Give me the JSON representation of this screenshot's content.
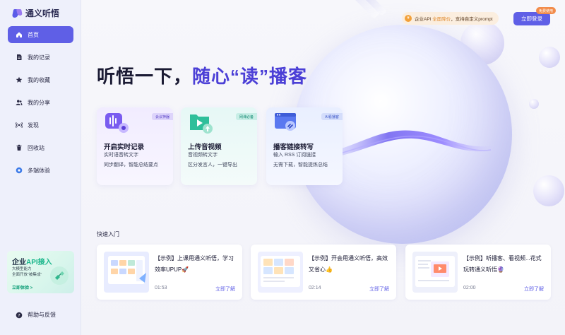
{
  "app": {
    "name": "通义听悟"
  },
  "sidebar": {
    "items": [
      {
        "label": "首页",
        "icon": "home-icon",
        "active": true
      },
      {
        "label": "我的记录",
        "icon": "document-icon",
        "active": false
      },
      {
        "label": "我的收藏",
        "icon": "star-icon",
        "active": false
      },
      {
        "label": "我的分享",
        "icon": "users-icon",
        "active": false
      },
      {
        "label": "发现",
        "icon": "radio-icon",
        "active": false
      },
      {
        "label": "回收站",
        "icon": "trash-icon",
        "active": false
      },
      {
        "label": "多端体验",
        "icon": "devices-icon",
        "active": false
      }
    ],
    "promo": {
      "title_a": "企业",
      "title_b": "API接入",
      "line1": "大模型能力",
      "line2": "全面开放“被集成”",
      "cta": "立即体验 >"
    },
    "help": "帮助与反馈"
  },
  "header": {
    "api_pill_a": "企业API",
    "api_pill_b": "全面降价",
    "api_pill_c": "，支持自定义prompt",
    "login": "立即登录",
    "badge": "免费使用"
  },
  "hero": {
    "title_a": "听悟一下，",
    "title_b": "随心“读”播客"
  },
  "features": [
    {
      "tag": "会议神器",
      "title": "开启实时记录",
      "line1": "实时语音转文字",
      "line2": "同步翻译，智能总结要点"
    },
    {
      "tag": "网课必备",
      "title": "上传音视频",
      "line1": "音视频转文字",
      "line2": "区分发言人，一键导出"
    },
    {
      "tag": "AI看播客",
      "title": "播客链接转写",
      "line1": "输入 RSS 订阅链接",
      "line2": "无需下载，智能提炼总结"
    }
  ],
  "quick": {
    "title": "快速入门",
    "items": [
      {
        "text": "【示例】上课用通义听悟，学习效率UPUP🚀",
        "time": "01:53",
        "link": "立即了解"
      },
      {
        "text": "【示例】开会用通义听悟，高效又省心👍",
        "time": "02:14",
        "link": "立即了解"
      },
      {
        "text": "【示例】听播客、看视频...花式玩转通义听悟🔮",
        "time": "02:00",
        "link": "立即了解"
      }
    ]
  },
  "colors": {
    "accent": "#5f5fe6",
    "headline_highlight": "#4b3fd6",
    "promo_green": "#17b58a",
    "pill_orange": "#f2a03a"
  }
}
